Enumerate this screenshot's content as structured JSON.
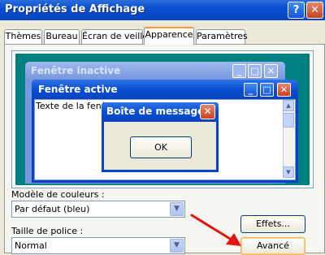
{
  "window": {
    "title": "Propriétés de Affichage",
    "help_glyph": "?",
    "close_glyph": "✕"
  },
  "tabs": [
    {
      "label": "Thèmes"
    },
    {
      "label": "Bureau"
    },
    {
      "label": "Écran de veille"
    },
    {
      "label": "Apparence",
      "active": true
    },
    {
      "label": "Paramètres"
    }
  ],
  "preview": {
    "inactive_title": "Fenêtre inactive",
    "active_title": "Fenêtre active",
    "window_text": "Texte de la fenêtre",
    "messagebox": {
      "title": "Boîte de message",
      "ok_label": "OK"
    },
    "min_glyph": "_",
    "max_glyph": "□",
    "close_glyph": "✕",
    "scroll_up_glyph": "▲",
    "scroll_down_glyph": "▼"
  },
  "controls": {
    "color_scheme_label": "Modèle de couleurs :",
    "color_scheme_value": "Par défaut (bleu)",
    "font_size_label": "Taille de police :",
    "font_size_value": "Normal",
    "effects_label": "Effets...",
    "advanced_label": "Avancé",
    "combo_arrow_glyph": "▼"
  },
  "colors": {
    "title_blue": "#0a4ed2",
    "desktop_teal": "#008080",
    "annotation_arrow": "#e3140f"
  }
}
